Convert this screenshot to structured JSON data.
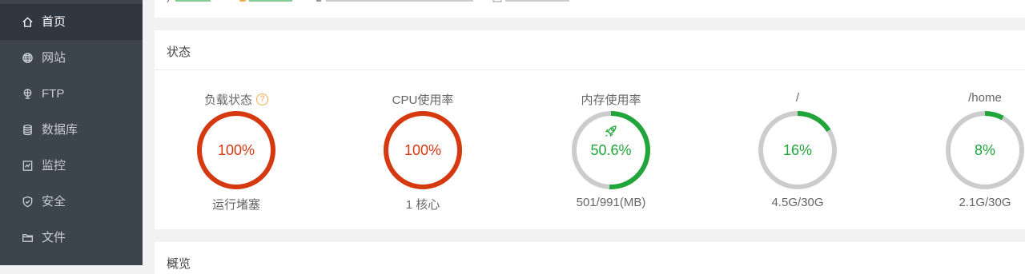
{
  "sidebar": {
    "items": [
      {
        "label": "首页",
        "icon": "home-icon",
        "active": true
      },
      {
        "label": "网站",
        "icon": "globe-icon",
        "active": false
      },
      {
        "label": "FTP",
        "icon": "ftp-icon",
        "active": false
      },
      {
        "label": "数据库",
        "icon": "database-icon",
        "active": false
      },
      {
        "label": "监控",
        "icon": "monitor-icon",
        "active": false
      },
      {
        "label": "安全",
        "icon": "shield-icon",
        "active": false
      },
      {
        "label": "文件",
        "icon": "folder-icon",
        "active": false
      }
    ]
  },
  "status": {
    "title": "状态",
    "gauges": [
      {
        "title": "负载状态",
        "value": "100%",
        "percent": 100,
        "subtitle": "运行堵塞",
        "color": "#d63810",
        "help": "?"
      },
      {
        "title": "CPU使用率",
        "value": "100%",
        "percent": 100,
        "subtitle": "1 核心",
        "color": "#d63810"
      },
      {
        "title": "内存使用率",
        "value": "50.6%",
        "percent": 50.6,
        "subtitle": "501/991(MB)",
        "color": "#20a53a"
      },
      {
        "title": "/",
        "value": "16%",
        "percent": 16,
        "subtitle": "4.5G/30G",
        "color": "#20a53a"
      },
      {
        "title": "/home",
        "value": "8%",
        "percent": 8,
        "subtitle": "2.1G/30G",
        "color": "#20a53a"
      }
    ]
  },
  "overview": {
    "title": "概览"
  },
  "colors": {
    "sidebar_bg": "#3c444d",
    "sidebar_active": "#303740",
    "danger": "#d63810",
    "ok": "#20a53a",
    "track": "#cccccc"
  }
}
